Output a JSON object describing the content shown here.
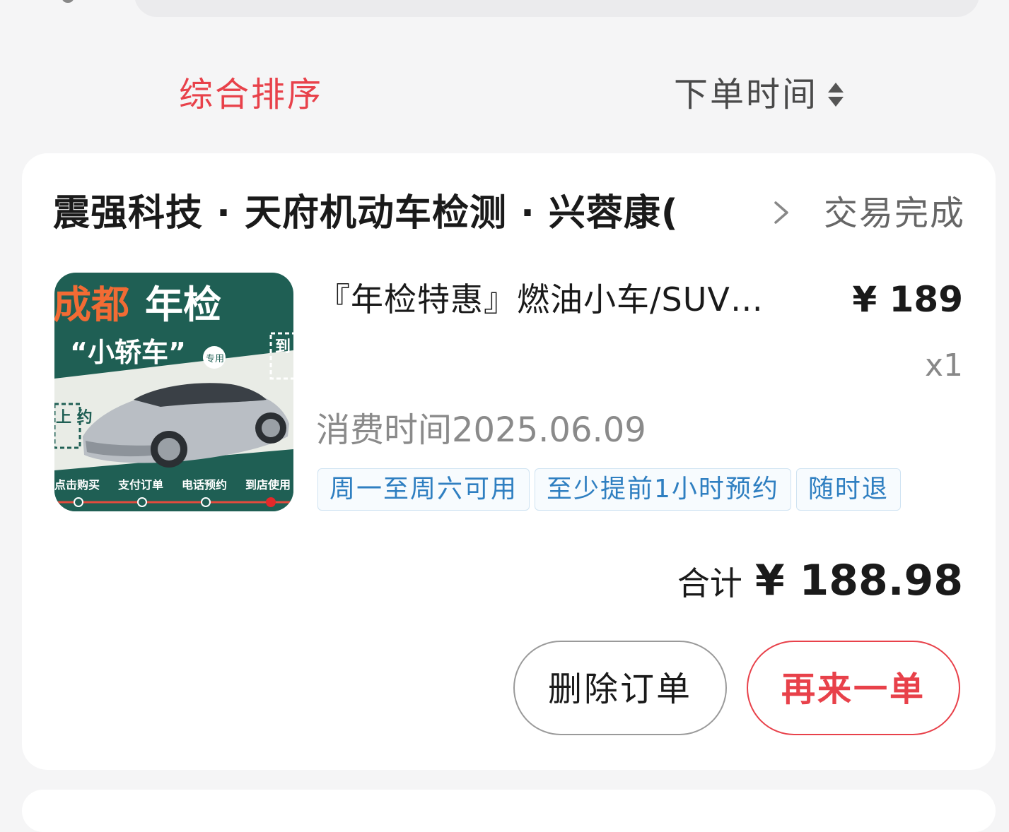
{
  "sort_bar": {
    "comprehensive_label": "综合排序",
    "order_time_label": "下单时间"
  },
  "order": {
    "shop_name": "震强科技 · 天府机动车检测 · 兴蓉康(",
    "status": "交易完成",
    "product": {
      "title": "『年检特惠』燃油小车/SUV…",
      "price": "¥ 189",
      "quantity": "x1",
      "consume_time": "消费时间2025.06.09",
      "image": {
        "headline_a": "成都",
        "headline_b": "年检",
        "subtitle": "“小轿车”",
        "subtitle_badge": "专用",
        "side_text_right": "到 即",
        "side_text_left": "上 约",
        "steps": [
          "点击购买",
          "支付订单",
          "电话预约",
          "到店使用"
        ]
      },
      "tags": [
        "周一至周六可用",
        "至少提前1小时预约",
        "随时退"
      ]
    },
    "total_label": "合计",
    "total_amount": "¥ 188.98",
    "buttons": {
      "delete": "删除订单",
      "reorder": "再来一单"
    }
  },
  "colors": {
    "accent_red": "#e8414a",
    "tag_blue": "#2f7fc1",
    "card_bg": "#ffffff",
    "page_bg": "#f5f5f6",
    "thumb_green": "#1f5f54"
  }
}
